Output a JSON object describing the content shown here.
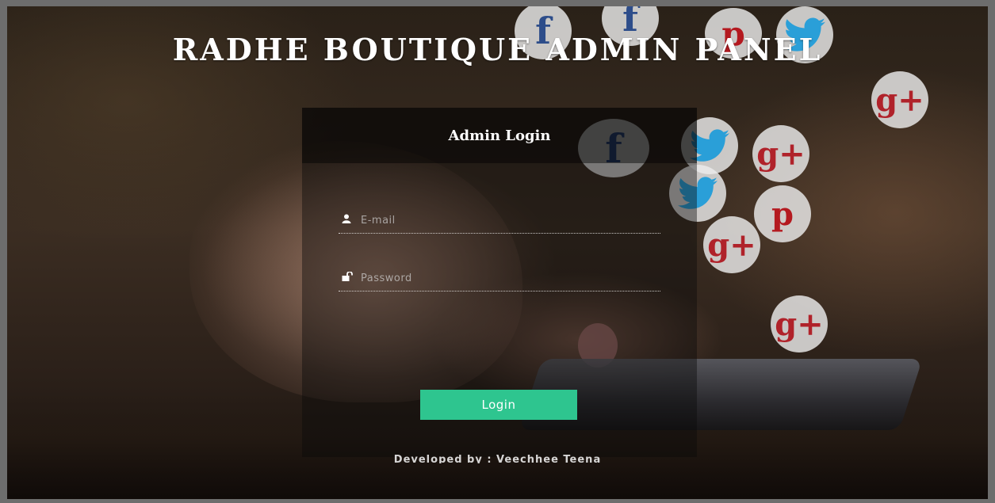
{
  "header": {
    "title": "RADHE BOUTIQUE ADMIN PANEL"
  },
  "login": {
    "heading": "Admin Login",
    "email_placeholder": "E-mail",
    "email_value": "",
    "password_placeholder": "Password",
    "password_value": "",
    "button_label": "Login"
  },
  "footer": {
    "credit": "Developed by : Veechhee Teena"
  },
  "background_icons": {
    "facebook": "f",
    "google_plus": "g+",
    "pinterest": "p",
    "twitter": "twitter-bird"
  },
  "colors": {
    "accent": "#2ec58f",
    "facebook": "#2d4d8a",
    "twitter": "#2a9fd8",
    "google_plus": "#b0222a",
    "pinterest": "#b4191f"
  }
}
